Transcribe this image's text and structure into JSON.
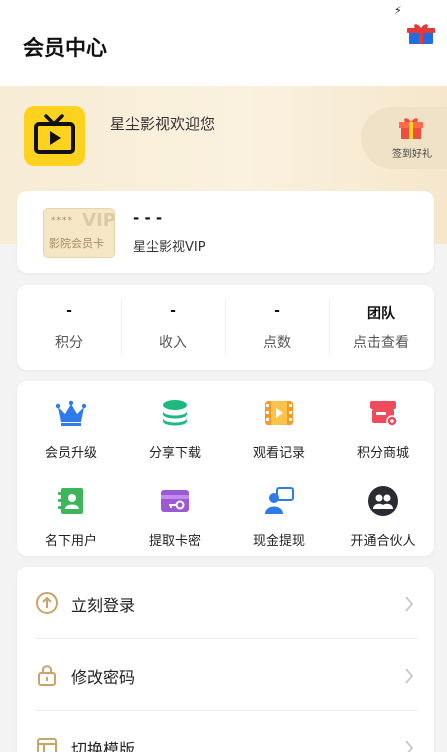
{
  "header": {
    "title": "会员中心"
  },
  "banner": {
    "welcome": "星尘影视欢迎您",
    "checkin_label": "签到好礼"
  },
  "vip": {
    "card_label": "影院会员卡",
    "card_dots": "****",
    "card_vip": "VIP",
    "dash": "- - -",
    "name": "星尘影视VIP"
  },
  "stats": [
    {
      "value": "-",
      "label": "积分"
    },
    {
      "value": "-",
      "label": "收入"
    },
    {
      "value": "-",
      "label": "点数"
    },
    {
      "value": "团队",
      "label": "点击查看"
    }
  ],
  "grid": [
    {
      "label": "会员升级",
      "icon": "crown-icon"
    },
    {
      "label": "分享下载",
      "icon": "stack-icon"
    },
    {
      "label": "观看记录",
      "icon": "film-icon"
    },
    {
      "label": "积分商城",
      "icon": "shop-icon"
    },
    {
      "label": "名下用户",
      "icon": "contact-book-icon"
    },
    {
      "label": "提取卡密",
      "icon": "card-key-icon"
    },
    {
      "label": "现金提现",
      "icon": "user-chat-icon"
    },
    {
      "label": "开通合伙人",
      "icon": "partner-icon"
    }
  ],
  "menu": [
    {
      "label": "立刻登录",
      "icon": "login-icon"
    },
    {
      "label": "修改密码",
      "icon": "lock-icon"
    },
    {
      "label": "切换模版",
      "icon": "template-icon"
    }
  ],
  "colors": {
    "accent_yellow": "#ffd21f",
    "banner_bg": "#f8eed9",
    "page_bg": "#f3f3f3"
  }
}
